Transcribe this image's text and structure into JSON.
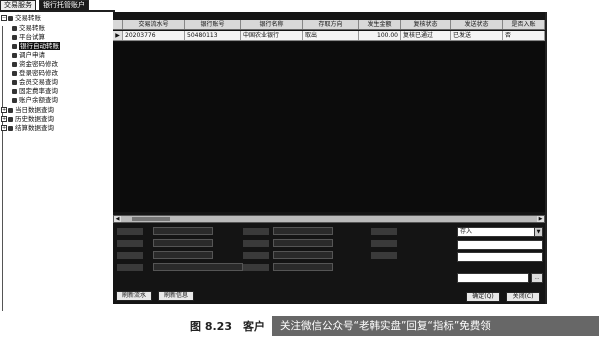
{
  "tabs": [
    "交易服务",
    "银行托管账户"
  ],
  "tree": {
    "root": "交易转账",
    "items": [
      "交易转账",
      "平台试算",
      "银行自动转账",
      "调户申请",
      "资金密码修改",
      "登录密码修改",
      "会员交易查询",
      "固定费率查询",
      "账户余额查询",
      "当日数据查询",
      "历史数据查询",
      "结算数据查询"
    ]
  },
  "grid": {
    "columns": [
      "交易流水号",
      "银行账号",
      "银行名称",
      "存取方向",
      "发生金额",
      "复核状态",
      "发送状态",
      "是否入账"
    ],
    "rows": [
      [
        "20203776",
        "50480113",
        "中国农业银行",
        "取出",
        "100.00",
        "复核已通过",
        "已发送",
        "否"
      ]
    ],
    "row_marker": "▶ 1"
  },
  "form": {
    "direction_value": "存入"
  },
  "buttons": {
    "reset_flow": "刷新流水",
    "reset_info": "刷新信息",
    "confirm": "确定(Q)",
    "close": "关闭(C)"
  },
  "caption": "图 8.23　客户",
  "watermark": "关注微信公众号“老韩实盘”回复“指标”免费领"
}
